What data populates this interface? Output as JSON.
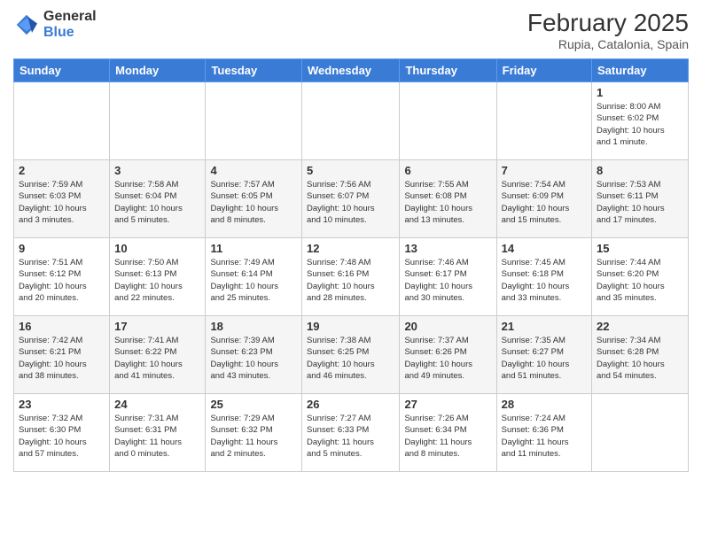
{
  "header": {
    "logo_general": "General",
    "logo_blue": "Blue",
    "month_year": "February 2025",
    "location": "Rupia, Catalonia, Spain"
  },
  "days_of_week": [
    "Sunday",
    "Monday",
    "Tuesday",
    "Wednesday",
    "Thursday",
    "Friday",
    "Saturday"
  ],
  "weeks": [
    [
      {
        "day": "",
        "info": ""
      },
      {
        "day": "",
        "info": ""
      },
      {
        "day": "",
        "info": ""
      },
      {
        "day": "",
        "info": ""
      },
      {
        "day": "",
        "info": ""
      },
      {
        "day": "",
        "info": ""
      },
      {
        "day": "1",
        "info": "Sunrise: 8:00 AM\nSunset: 6:02 PM\nDaylight: 10 hours\nand 1 minute."
      }
    ],
    [
      {
        "day": "2",
        "info": "Sunrise: 7:59 AM\nSunset: 6:03 PM\nDaylight: 10 hours\nand 3 minutes."
      },
      {
        "day": "3",
        "info": "Sunrise: 7:58 AM\nSunset: 6:04 PM\nDaylight: 10 hours\nand 5 minutes."
      },
      {
        "day": "4",
        "info": "Sunrise: 7:57 AM\nSunset: 6:05 PM\nDaylight: 10 hours\nand 8 minutes."
      },
      {
        "day": "5",
        "info": "Sunrise: 7:56 AM\nSunset: 6:07 PM\nDaylight: 10 hours\nand 10 minutes."
      },
      {
        "day": "6",
        "info": "Sunrise: 7:55 AM\nSunset: 6:08 PM\nDaylight: 10 hours\nand 13 minutes."
      },
      {
        "day": "7",
        "info": "Sunrise: 7:54 AM\nSunset: 6:09 PM\nDaylight: 10 hours\nand 15 minutes."
      },
      {
        "day": "8",
        "info": "Sunrise: 7:53 AM\nSunset: 6:11 PM\nDaylight: 10 hours\nand 17 minutes."
      }
    ],
    [
      {
        "day": "9",
        "info": "Sunrise: 7:51 AM\nSunset: 6:12 PM\nDaylight: 10 hours\nand 20 minutes."
      },
      {
        "day": "10",
        "info": "Sunrise: 7:50 AM\nSunset: 6:13 PM\nDaylight: 10 hours\nand 22 minutes."
      },
      {
        "day": "11",
        "info": "Sunrise: 7:49 AM\nSunset: 6:14 PM\nDaylight: 10 hours\nand 25 minutes."
      },
      {
        "day": "12",
        "info": "Sunrise: 7:48 AM\nSunset: 6:16 PM\nDaylight: 10 hours\nand 28 minutes."
      },
      {
        "day": "13",
        "info": "Sunrise: 7:46 AM\nSunset: 6:17 PM\nDaylight: 10 hours\nand 30 minutes."
      },
      {
        "day": "14",
        "info": "Sunrise: 7:45 AM\nSunset: 6:18 PM\nDaylight: 10 hours\nand 33 minutes."
      },
      {
        "day": "15",
        "info": "Sunrise: 7:44 AM\nSunset: 6:20 PM\nDaylight: 10 hours\nand 35 minutes."
      }
    ],
    [
      {
        "day": "16",
        "info": "Sunrise: 7:42 AM\nSunset: 6:21 PM\nDaylight: 10 hours\nand 38 minutes."
      },
      {
        "day": "17",
        "info": "Sunrise: 7:41 AM\nSunset: 6:22 PM\nDaylight: 10 hours\nand 41 minutes."
      },
      {
        "day": "18",
        "info": "Sunrise: 7:39 AM\nSunset: 6:23 PM\nDaylight: 10 hours\nand 43 minutes."
      },
      {
        "day": "19",
        "info": "Sunrise: 7:38 AM\nSunset: 6:25 PM\nDaylight: 10 hours\nand 46 minutes."
      },
      {
        "day": "20",
        "info": "Sunrise: 7:37 AM\nSunset: 6:26 PM\nDaylight: 10 hours\nand 49 minutes."
      },
      {
        "day": "21",
        "info": "Sunrise: 7:35 AM\nSunset: 6:27 PM\nDaylight: 10 hours\nand 51 minutes."
      },
      {
        "day": "22",
        "info": "Sunrise: 7:34 AM\nSunset: 6:28 PM\nDaylight: 10 hours\nand 54 minutes."
      }
    ],
    [
      {
        "day": "23",
        "info": "Sunrise: 7:32 AM\nSunset: 6:30 PM\nDaylight: 10 hours\nand 57 minutes."
      },
      {
        "day": "24",
        "info": "Sunrise: 7:31 AM\nSunset: 6:31 PM\nDaylight: 11 hours\nand 0 minutes."
      },
      {
        "day": "25",
        "info": "Sunrise: 7:29 AM\nSunset: 6:32 PM\nDaylight: 11 hours\nand 2 minutes."
      },
      {
        "day": "26",
        "info": "Sunrise: 7:27 AM\nSunset: 6:33 PM\nDaylight: 11 hours\nand 5 minutes."
      },
      {
        "day": "27",
        "info": "Sunrise: 7:26 AM\nSunset: 6:34 PM\nDaylight: 11 hours\nand 8 minutes."
      },
      {
        "day": "28",
        "info": "Sunrise: 7:24 AM\nSunset: 6:36 PM\nDaylight: 11 hours\nand 11 minutes."
      },
      {
        "day": "",
        "info": ""
      }
    ]
  ]
}
